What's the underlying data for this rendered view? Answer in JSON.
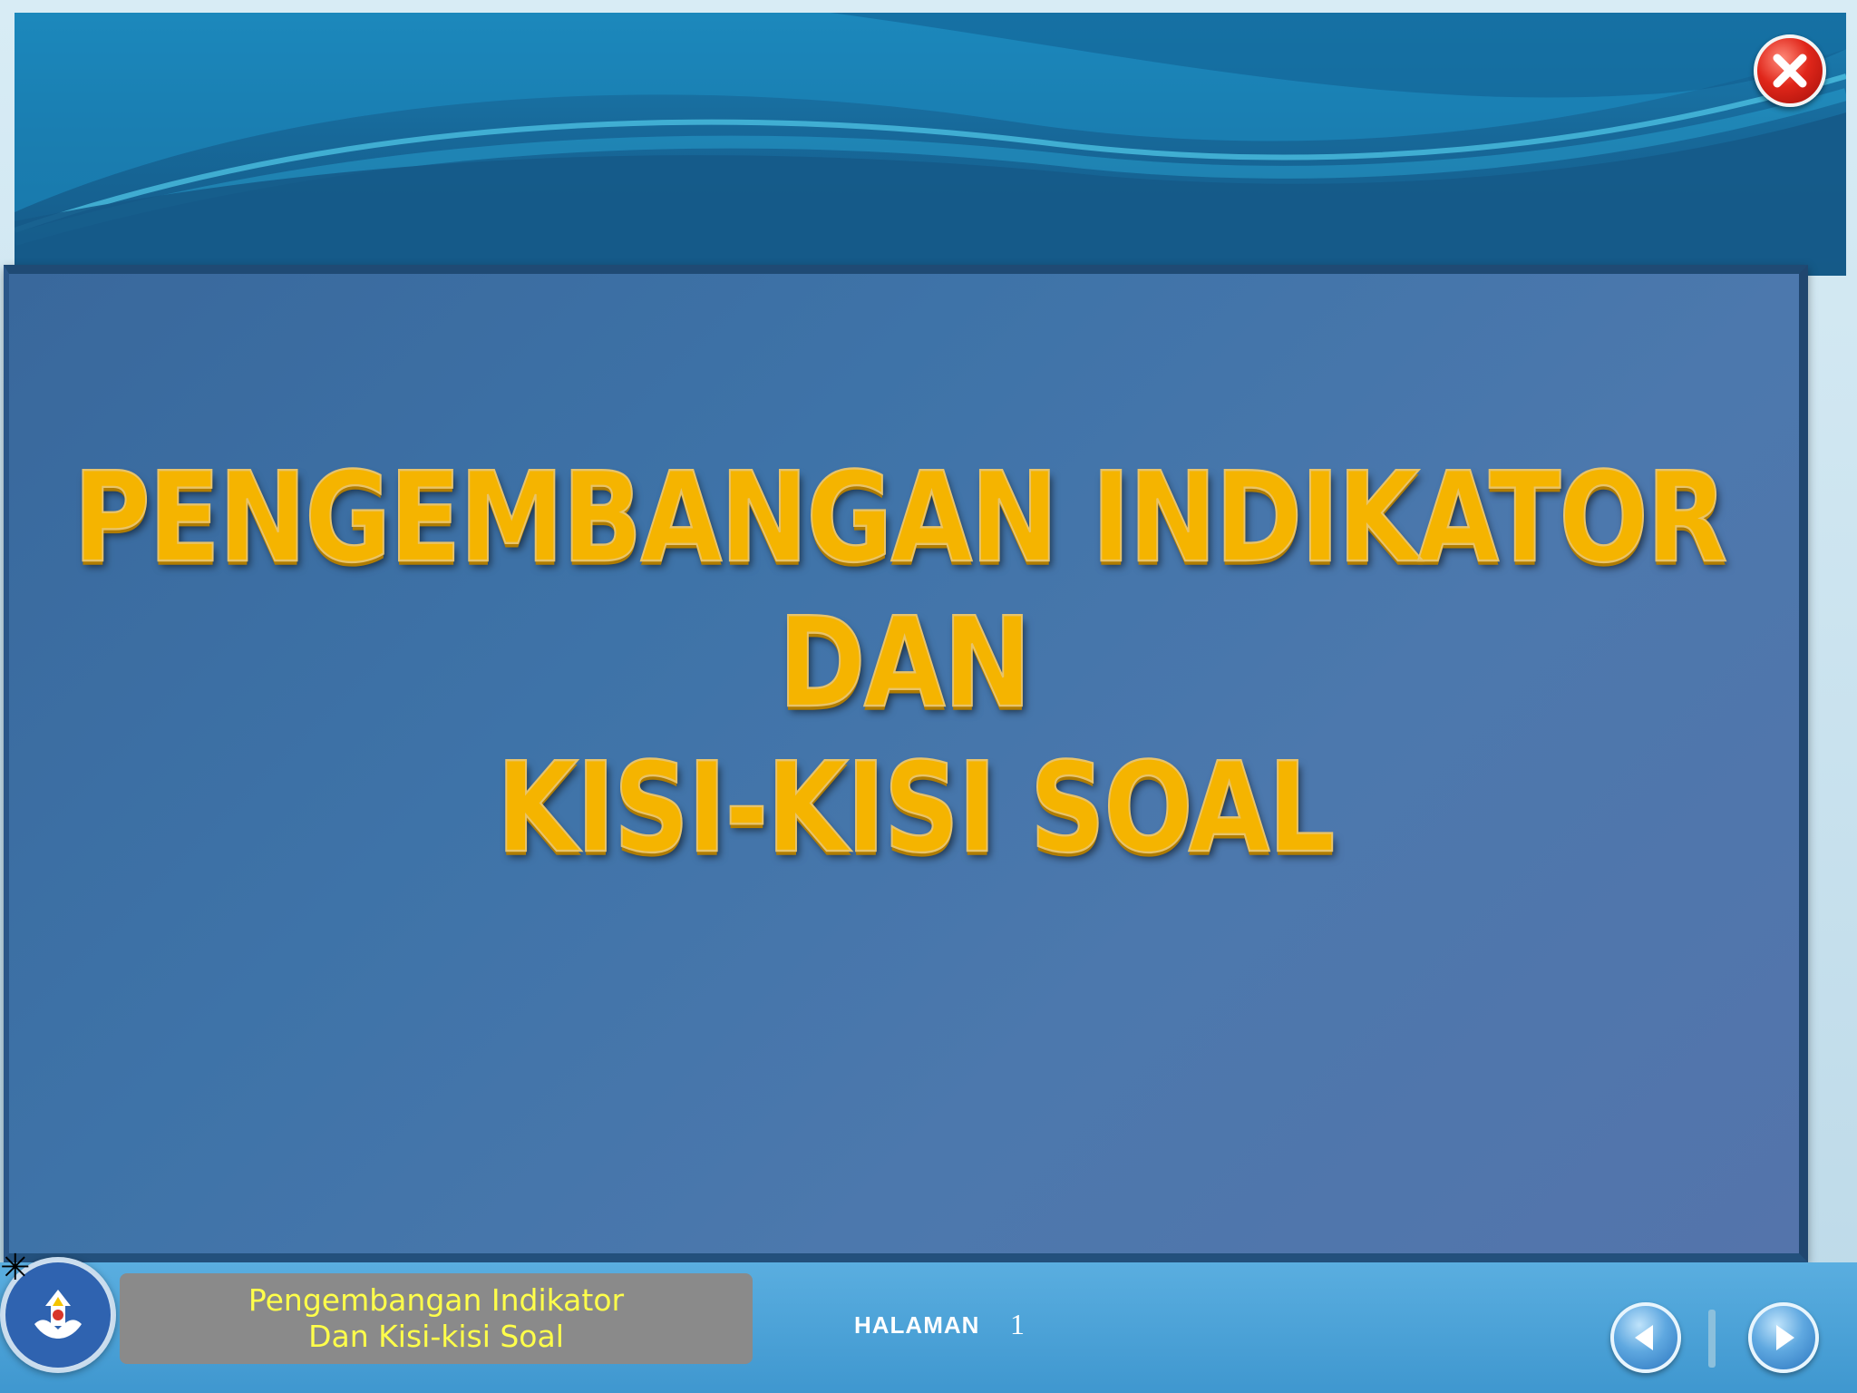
{
  "slide": {
    "title_lines": [
      "PENGEMBANGAN INDIKATOR",
      "DAN",
      "KISI-KISI SOAL"
    ]
  },
  "footer": {
    "caption_lines": [
      "Pengembangan Indikator",
      "Dan Kisi-kisi Soal"
    ],
    "page_label": "HALAMAN",
    "page_number": "1"
  },
  "icons": {
    "close": "close-icon",
    "prev": "arrow-left-icon",
    "next": "arrow-right-icon",
    "logo": "tut-wuri-handayani-logo"
  },
  "colors": {
    "title": "#f5b400",
    "caption_text": "#ffff4a",
    "panel": "#3e73a8",
    "close_button": "#e0261a"
  }
}
